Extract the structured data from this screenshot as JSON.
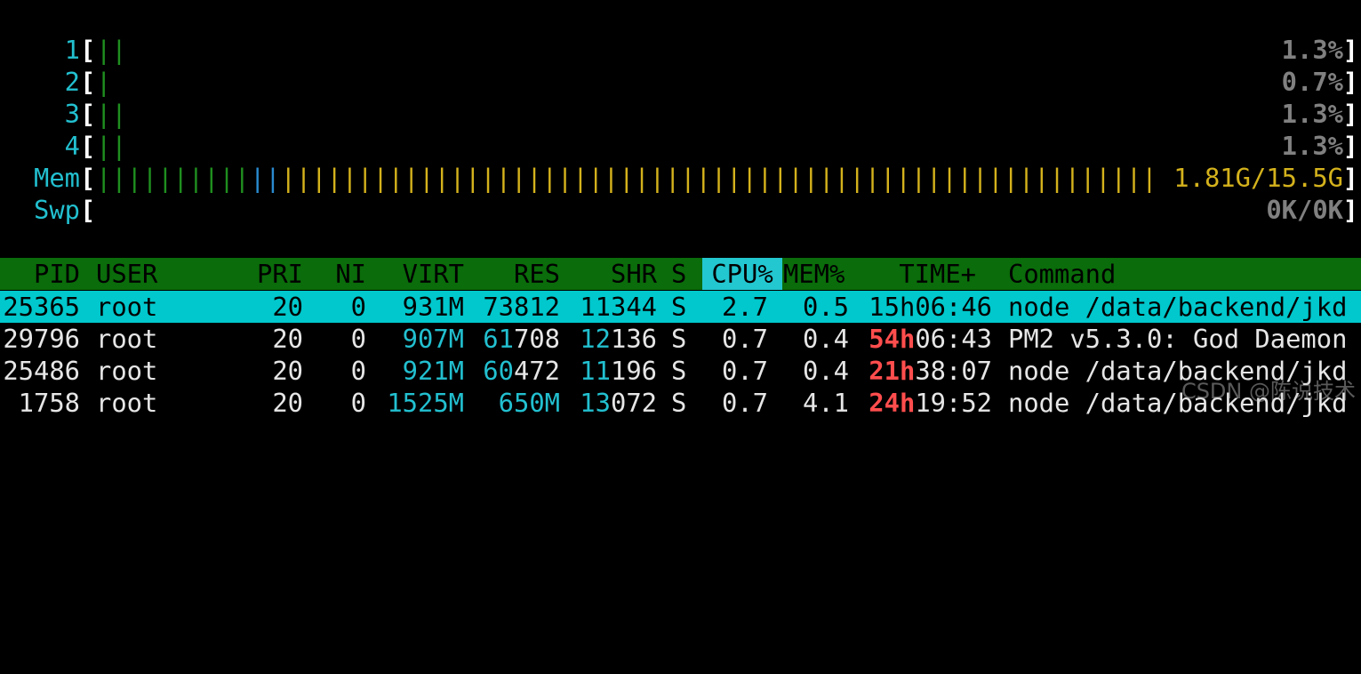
{
  "cpus": [
    {
      "label": "1",
      "bars": [
        {
          "c": "g",
          "t": "|"
        },
        {
          "c": "g",
          "t": "|"
        }
      ],
      "value": "1.3%"
    },
    {
      "label": "2",
      "bars": [
        {
          "c": "g",
          "t": "|"
        }
      ],
      "value": "0.7%"
    },
    {
      "label": "3",
      "bars": [
        {
          "c": "g",
          "t": "|"
        },
        {
          "c": "g",
          "t": "|"
        }
      ],
      "value": "1.3%"
    },
    {
      "label": "4",
      "bars": [
        {
          "c": "g",
          "t": "|"
        },
        {
          "c": "g",
          "t": "|"
        }
      ],
      "value": "1.3%"
    }
  ],
  "mem": {
    "label": "Mem",
    "value": "1.81G/15.5G",
    "green_bars": 10,
    "blue_bars": 2,
    "yellow_bars": 57
  },
  "swp": {
    "label": "Swp",
    "value": "0K/0K"
  },
  "bracket_open": "[",
  "bracket_close": "]",
  "header": {
    "pid": "PID",
    "user": "USER",
    "pri": "PRI",
    "ni": "NI",
    "virt": "VIRT",
    "res": "RES",
    "shr": "SHR",
    "s": "S",
    "cpu": "CPU%",
    "mem": "MEM%",
    "time": "TIME+",
    "command": "Command"
  },
  "processes": [
    {
      "pid": "25365",
      "user": "root",
      "pri": "20",
      "ni": "0",
      "virt_hi": "",
      "virt_lo": "931M",
      "res_hi": "",
      "res_lo": "73812",
      "shr_hi": "",
      "shr_lo": "11344",
      "s": "S",
      "cpu": "2.7",
      "mem": "0.5",
      "time_hi": "15h",
      "time_lo": "06:46",
      "command": "node /data/backend/jkd",
      "selected": true
    },
    {
      "pid": "29796",
      "user": "root",
      "pri": "20",
      "ni": "0",
      "virt_hi": "907M",
      "virt_lo": "",
      "res_hi": "61",
      "res_lo": "708",
      "shr_hi": "12",
      "shr_lo": "136",
      "s": "S",
      "cpu": "0.7",
      "mem": "0.4",
      "time_hi": "54h",
      "time_lo": "06:43",
      "command": "PM2 v5.3.0: God Daemon",
      "selected": false
    },
    {
      "pid": "25486",
      "user": "root",
      "pri": "20",
      "ni": "0",
      "virt_hi": "921M",
      "virt_lo": "",
      "res_hi": "60",
      "res_lo": "472",
      "shr_hi": "11",
      "shr_lo": "196",
      "s": "S",
      "cpu": "0.7",
      "mem": "0.4",
      "time_hi": "21h",
      "time_lo": "38:07",
      "command": "node /data/backend/jkd",
      "selected": false
    },
    {
      "pid": "1758",
      "user": "root",
      "pri": "20",
      "ni": "0",
      "virt_hi": "1525M",
      "virt_lo": "",
      "res_hi": "650M",
      "res_lo": "",
      "shr_hi": "13",
      "shr_lo": "072",
      "s": "S",
      "cpu": "0.7",
      "mem": "4.1",
      "time_hi": "24h",
      "time_lo": "19:52",
      "command": "node /data/backend/jkd",
      "selected": false
    }
  ],
  "watermark": "CSDN @陈说技术"
}
